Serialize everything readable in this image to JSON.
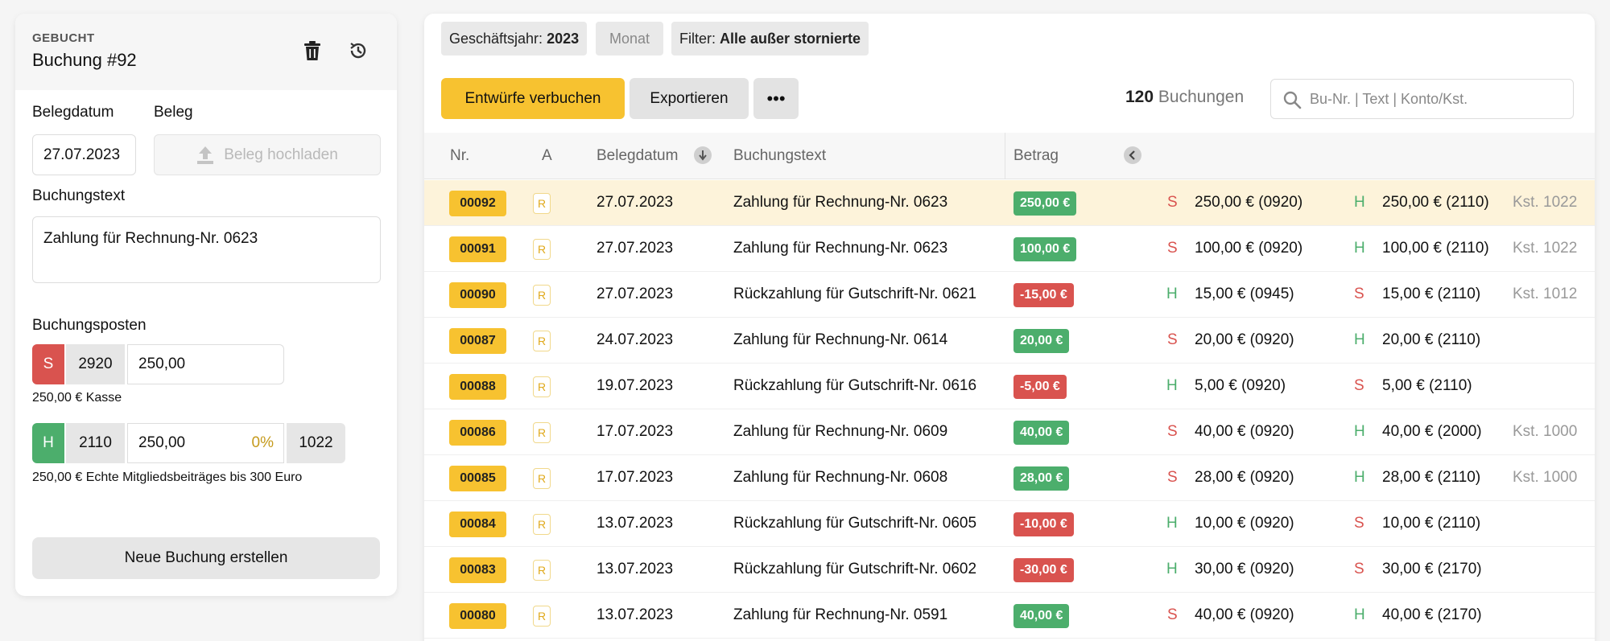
{
  "left": {
    "status": "GEBUCHT",
    "title": "Buchung #92",
    "belegdatum_label": "Belegdatum",
    "belegdatum_value": "27.07.2023",
    "beleg_label": "Beleg",
    "upload_label": "Beleg hochladen",
    "buchungstext_label": "Buchungstext",
    "buchungstext_value": "Zahlung für Rechnung-Nr. 0623",
    "posten_label": "Buchungsposten",
    "posten": [
      {
        "side": "S",
        "account": "2920",
        "amount": "250,00",
        "note": "250,00 € Kasse"
      },
      {
        "side": "H",
        "account": "2110",
        "amount": "250,00",
        "percent": "0%",
        "kst": "1022",
        "note": "250,00 € Echte Mitgliedsbeiträges bis 300 Euro"
      }
    ],
    "new_button": "Neue Buchung erstellen"
  },
  "toolbar": {
    "chip_year_label": "Geschäftsjahr:",
    "chip_year_value": "2023",
    "chip_month": "Monat",
    "chip_filter_label": "Filter:",
    "chip_filter_value": "Alle außer stornierte",
    "post_drafts": "Entwürfe verbuchen",
    "export": "Exportieren",
    "more": "•••",
    "count_number": "120",
    "count_label": "Buchungen",
    "search_placeholder": "Bu-Nr. | Text | Konto/Kst."
  },
  "table": {
    "headers": {
      "nr": "Nr.",
      "a": "A",
      "date": "Belegdatum",
      "text": "Buchungstext",
      "amount": "Betrag"
    },
    "rows": [
      {
        "nr": "00092",
        "a": "R",
        "date": "27.07.2023",
        "text": "Zahlung für Rechnung-Nr. 0623",
        "amount": "250,00 €",
        "sign": "pos",
        "s1": "S",
        "p1": "250,00 € (0920)",
        "s2": "H",
        "p2": "250,00 € (2110)",
        "kst": "Kst. 1022"
      },
      {
        "nr": "00091",
        "a": "R",
        "date": "27.07.2023",
        "text": "Zahlung für Rechnung-Nr. 0623",
        "amount": "100,00 €",
        "sign": "pos",
        "s1": "S",
        "p1": "100,00 € (0920)",
        "s2": "H",
        "p2": "100,00 € (2110)",
        "kst": "Kst. 1022"
      },
      {
        "nr": "00090",
        "a": "R",
        "date": "27.07.2023",
        "text": "Rückzahlung für Gutschrift-Nr. 0621",
        "amount": "-15,00 €",
        "sign": "neg",
        "s1": "H",
        "p1": "15,00 € (0945)",
        "s2": "S",
        "p2": "15,00 € (2110)",
        "kst": "Kst. 1012"
      },
      {
        "nr": "00087",
        "a": "R",
        "date": "24.07.2023",
        "text": "Zahlung für Rechnung-Nr. 0614",
        "amount": "20,00 €",
        "sign": "pos",
        "s1": "S",
        "p1": "20,00 € (0920)",
        "s2": "H",
        "p2": "20,00 € (2110)",
        "kst": ""
      },
      {
        "nr": "00088",
        "a": "R",
        "date": "19.07.2023",
        "text": "Rückzahlung für Gutschrift-Nr. 0616",
        "amount": "-5,00 €",
        "sign": "neg",
        "s1": "H",
        "p1": "5,00 € (0920)",
        "s2": "S",
        "p2": "5,00 € (2110)",
        "kst": ""
      },
      {
        "nr": "00086",
        "a": "R",
        "date": "17.07.2023",
        "text": "Zahlung für Rechnung-Nr. 0609",
        "amount": "40,00 €",
        "sign": "pos",
        "s1": "S",
        "p1": "40,00 € (0920)",
        "s2": "H",
        "p2": "40,00 € (2000)",
        "kst": "Kst. 1000"
      },
      {
        "nr": "00085",
        "a": "R",
        "date": "17.07.2023",
        "text": "Zahlung für Rechnung-Nr. 0608",
        "amount": "28,00 €",
        "sign": "pos",
        "s1": "S",
        "p1": "28,00 € (0920)",
        "s2": "H",
        "p2": "28,00 € (2110)",
        "kst": "Kst. 1000"
      },
      {
        "nr": "00084",
        "a": "R",
        "date": "13.07.2023",
        "text": "Rückzahlung für Gutschrift-Nr. 0605",
        "amount": "-10,00 €",
        "sign": "neg",
        "s1": "H",
        "p1": "10,00 € (0920)",
        "s2": "S",
        "p2": "10,00 € (2110)",
        "kst": ""
      },
      {
        "nr": "00083",
        "a": "R",
        "date": "13.07.2023",
        "text": "Rückzahlung für Gutschrift-Nr. 0602",
        "amount": "-30,00 €",
        "sign": "neg",
        "s1": "H",
        "p1": "30,00 € (0920)",
        "s2": "S",
        "p2": "30,00 € (2170)",
        "kst": ""
      },
      {
        "nr": "00080",
        "a": "R",
        "date": "13.07.2023",
        "text": "Zahlung für Rechnung-Nr. 0591",
        "amount": "40,00 €",
        "sign": "pos",
        "s1": "S",
        "p1": "40,00 € (0920)",
        "s2": "H",
        "p2": "40,00 € (2170)",
        "kst": ""
      }
    ]
  },
  "colors": {
    "accent": "#f7c230",
    "debit": "#d9534f",
    "credit": "#4cae6c"
  }
}
